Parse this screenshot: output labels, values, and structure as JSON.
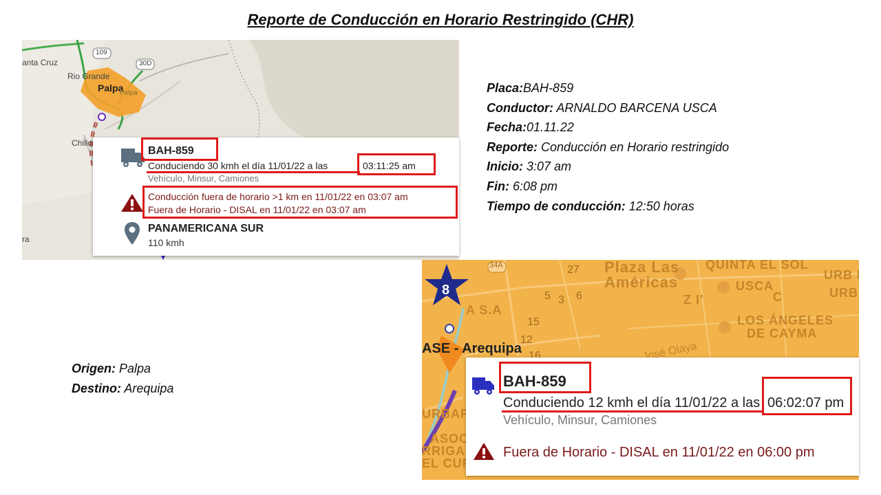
{
  "title": "Reporte de Conducción en Horario Restringido (CHR)",
  "report": {
    "plate_label": "Placa:",
    "plate_value": "BAH-859",
    "driver_label": "Conductor:",
    "driver_value": " ARNALDO BARCENA USCA",
    "date_label": "Fecha:",
    "date_value": "01.11.22",
    "report_label": "Reporte:",
    "report_value": " Conducción en Horario restringido",
    "start_label": "Inicio:",
    "start_value": " 3:07 am",
    "end_label": "Fin:",
    "end_value": " 6:08 pm",
    "duration_label": "Tiempo de conducción:",
    "duration_value": " 12:50  horas"
  },
  "route": {
    "origin_label": "Origen:",
    "origin_value": " Palpa",
    "destination_label": "Destino:",
    "destination_value": " Arequipa"
  },
  "map1": {
    "labels": {
      "santa_cruz": "anta Cruz",
      "rio_grande": "Rio Grande",
      "palpa": "Palpa",
      "palpa_small": "Palpa",
      "chillo": "Chillo",
      "ra": "ra",
      "route_109": "109",
      "route_30d": "30D"
    },
    "card": {
      "plate": "BAH-859",
      "driving": "Conduciendo 30 kmh el día 11/01/22 a las ",
      "time": "03:11:25 am",
      "vehicle": "Vehículo, Minsur, Camiones",
      "alert_line1": "Conducción fuera de horario >1 km en 11/01/22 en 03:07 am",
      "alert_line2": "Fuera de Horario - DISAL en 11/01/22 en 03:07 am",
      "road": "PANAMERICANA SUR",
      "speed": "110 kmh"
    }
  },
  "map2": {
    "labels": {
      "route_34a": "34A",
      "star_number": "8",
      "plaza": "Plaza Las",
      "americas": "Américas",
      "quinta": "QUINTA EL SOL",
      "urb1": "URB L",
      "urb2": "URB",
      "usca": "USCA",
      "zi": "Z I'",
      "c": "C",
      "angeles": "LOS ÁNGELES",
      "cayma": "DE CAYMA",
      "olaya": "José Olaya",
      "arequipa": "ASE - Arequipa",
      "sa": "A S.A",
      "asoc": "ASOC",
      "rrigaci": "RRIGACI",
      "elcura": "EL CURA",
      "urbart": "URBART",
      "n27": "27",
      "n5": "5",
      "n3": "3",
      "n6": "6",
      "n15": "15",
      "n12": "12",
      "n16": "16"
    },
    "card": {
      "plate": "BAH-859",
      "driving": "Conduciendo 12 kmh el día 11/01/22 a las ",
      "time": "06:02:07 pm",
      "vehicle": "Vehículo, Minsur, Camiones",
      "alert": "Fuera de Horario - DISAL en 11/01/22 en 06:00 pm"
    }
  },
  "colors": {
    "highlight_red": "#e01a1a",
    "alert_text": "#7a1a1a",
    "truck_icon_1": "#5b6f80",
    "truck_icon_2": "#2a2fc0",
    "warning_icon": "#8b1010",
    "map2_background": "#f2b34a",
    "star": "#1e2a8c"
  },
  "icons": [
    "truck-icon",
    "warning-icon",
    "location-pin-icon",
    "star-marker-icon"
  ]
}
